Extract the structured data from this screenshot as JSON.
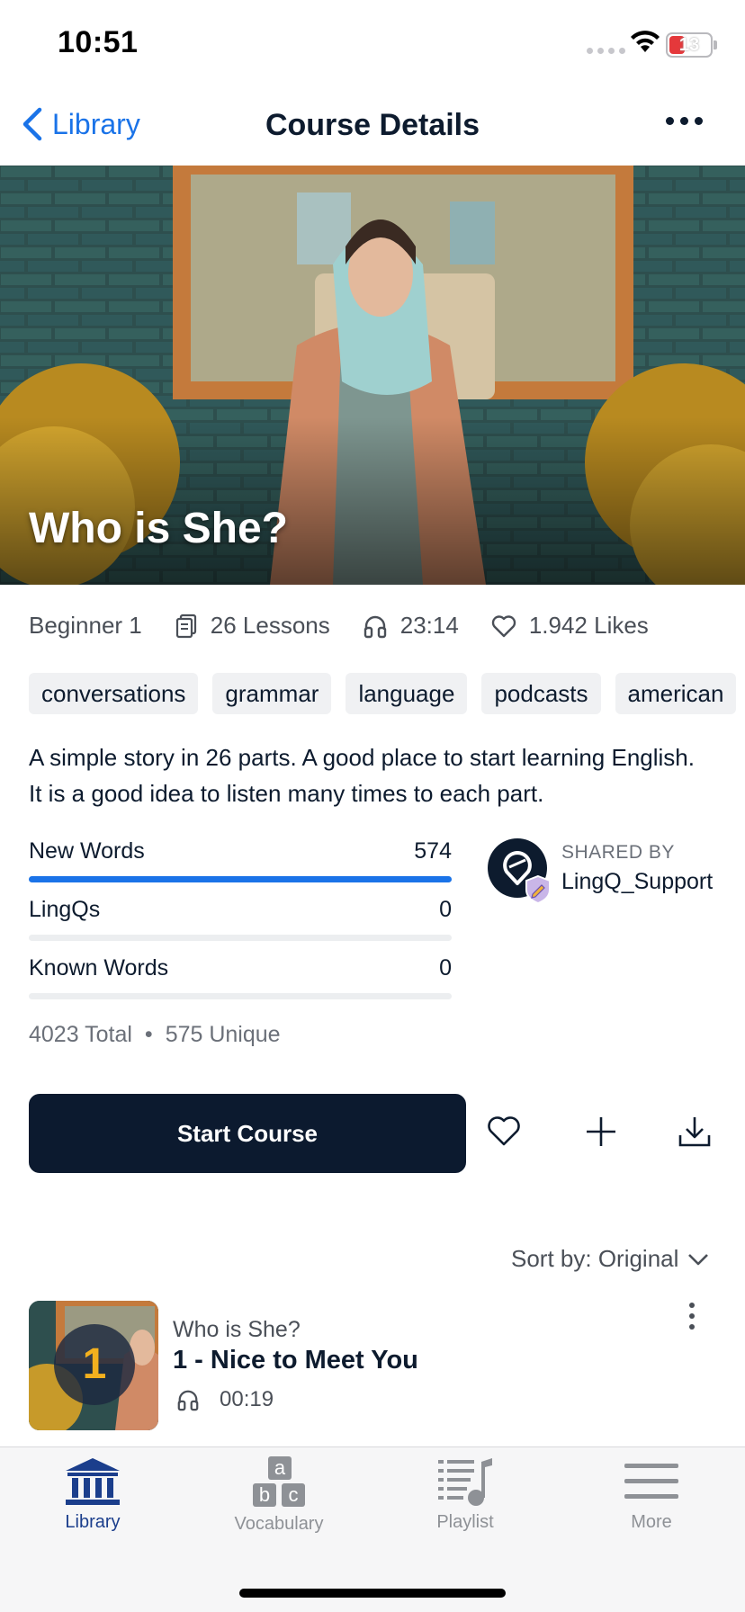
{
  "status_bar": {
    "time": "10:51",
    "battery": "13"
  },
  "nav": {
    "back_label": "Library",
    "title": "Course Details"
  },
  "hero": {
    "title": "Who is She?"
  },
  "stats": {
    "level": "Beginner 1",
    "lessons": "26 Lessons",
    "duration": "23:14",
    "likes": "1.942 Likes"
  },
  "tags": [
    "conversations",
    "grammar",
    "language",
    "podcasts",
    "american"
  ],
  "description": "A simple story in 26 parts. A good place to start learning English. It is a good idea to listen many times to each part.",
  "word_stats": {
    "new_words": {
      "label": "New Words",
      "value": "574",
      "fraction": 1.0
    },
    "lingqs": {
      "label": "LingQs",
      "value": "0",
      "fraction": 0
    },
    "known_words": {
      "label": "Known Words",
      "value": "0",
      "fraction": 0
    },
    "total": "4023 Total",
    "separator": "•",
    "unique": "575 Unique"
  },
  "shared_by": {
    "caption": "SHARED BY",
    "name": "LingQ_Support"
  },
  "actions": {
    "start_label": "Start Course"
  },
  "sort": {
    "label": "Sort by: Original"
  },
  "lesson": {
    "number": "1",
    "course": "Who is She?",
    "title": "1 - Nice to Meet You",
    "duration": "00:19"
  },
  "tab_bar": {
    "items": [
      {
        "label": "Library",
        "icon": "library-icon",
        "active": true
      },
      {
        "label": "Vocabulary",
        "icon": "vocabulary-icon",
        "active": false
      },
      {
        "label": "Playlist",
        "icon": "playlist-icon",
        "active": false
      },
      {
        "label": "More",
        "icon": "menu-icon",
        "active": false
      }
    ]
  },
  "colors": {
    "accent": "#1a73e8",
    "primary_dark": "#0c1a2f",
    "tab_active": "#1b3e8c",
    "lesson_number": "#f2b01e"
  }
}
